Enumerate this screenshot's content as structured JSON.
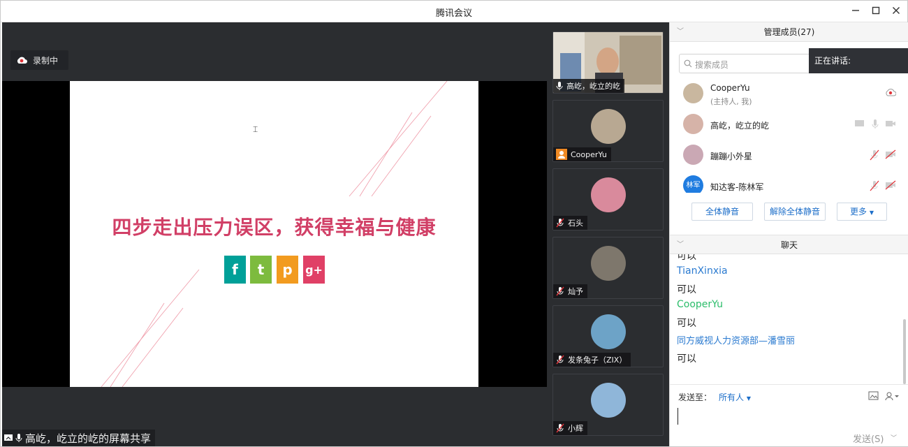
{
  "window": {
    "title": "腾讯会议"
  },
  "recording": {
    "label": "录制中"
  },
  "slide": {
    "title": "四步走出压力误区，获得幸福与健康",
    "social": [
      {
        "glyph": "f",
        "color": "#00a098",
        "icon": "facebook-icon"
      },
      {
        "glyph": "t",
        "color": "#7dbb3e",
        "icon": "twitter-icon"
      },
      {
        "glyph": "p",
        "color": "#f29b1f",
        "icon": "pinterest-icon"
      },
      {
        "glyph": "g+",
        "color": "#e04066",
        "icon": "google-plus-icon"
      }
    ]
  },
  "share_caption": "高屹，屹立的屹的屏幕共享",
  "thumbnails": [
    {
      "name": "高屹，屹立的屹",
      "kind": "video"
    },
    {
      "name": "CooperYu",
      "kind": "avatar",
      "color": "#b8a892"
    },
    {
      "name": "石头",
      "kind": "avatar",
      "color": "#d98a9c"
    },
    {
      "name": "灿予",
      "kind": "avatar",
      "color": "#7e776c"
    },
    {
      "name": "发条兔子（ZIX）",
      "kind": "avatar",
      "color": "#6da3c7"
    },
    {
      "name": "小辉",
      "kind": "avatar",
      "color": "#8fb6d9"
    }
  ],
  "members_panel": {
    "header": "管理成员(27)",
    "search_placeholder": "搜索成员",
    "speaking_label": "正在讲话:",
    "members": [
      {
        "name": "CooperYu",
        "sub": "(主持人, 我)",
        "color": "#c9b79f"
      },
      {
        "name": "高屹，屹立的屹",
        "sub": "",
        "color": "#d6b3a8"
      },
      {
        "name": "蹦蹦小外星",
        "sub": "",
        "color": "#caa8b4"
      },
      {
        "name": "知达客-陈林军",
        "sub": "",
        "color": "#1f7ce0",
        "initials": "林军"
      }
    ],
    "buttons": {
      "mute_all": "全体静音",
      "unmute_all": "解除全体静音",
      "more": "更多"
    }
  },
  "chat": {
    "header": "聊天",
    "messages": [
      {
        "type": "text",
        "text": "可以"
      },
      {
        "type": "name",
        "text": "TianXinxia",
        "color": "blue"
      },
      {
        "type": "text",
        "text": "可以"
      },
      {
        "type": "name",
        "text": "CooperYu",
        "color": "green"
      },
      {
        "type": "text",
        "text": "可以"
      },
      {
        "type": "name",
        "text": "同方威视人力资源部—潘雪丽",
        "color": "blue"
      },
      {
        "type": "text",
        "text": "可以"
      }
    ],
    "send_to_label": "发送至：",
    "send_to_value": "所有人",
    "send_button": "发送(S)"
  }
}
